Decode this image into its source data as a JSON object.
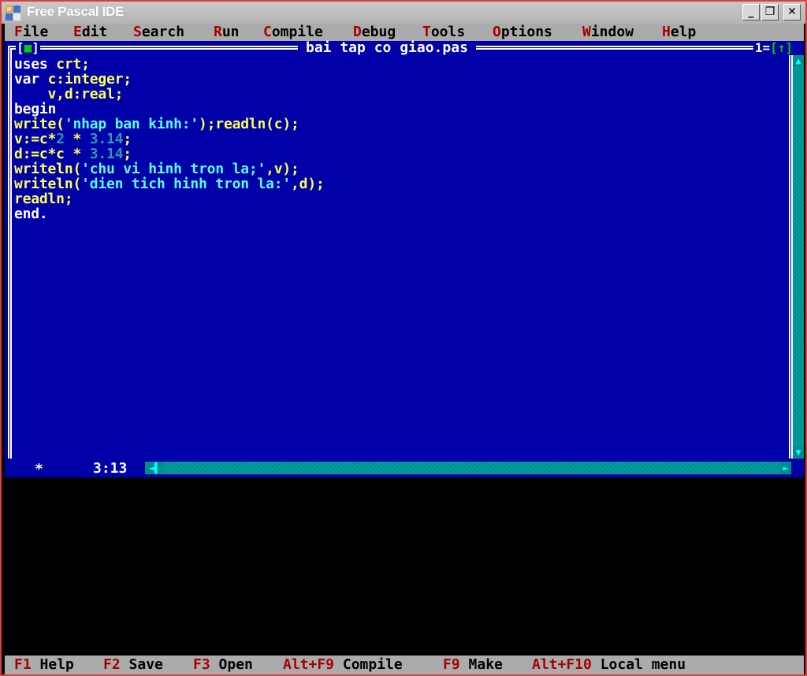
{
  "window": {
    "title": "Free Pascal IDE",
    "controls": {
      "minimize": "_",
      "restore": "❐",
      "close": "✕"
    }
  },
  "menu": [
    {
      "hotkey": "F",
      "rest": "ile"
    },
    {
      "hotkey": "E",
      "rest": "dit"
    },
    {
      "hotkey": "S",
      "rest": "earch"
    },
    {
      "hotkey": "R",
      "rest": "un"
    },
    {
      "hotkey": "C",
      "rest": "ompile"
    },
    {
      "hotkey": "D",
      "rest": "ebug"
    },
    {
      "hotkey": "T",
      "rest": "ools"
    },
    {
      "hotkey": "O",
      "rest": "ptions"
    },
    {
      "hotkey": "W",
      "rest": "indow"
    },
    {
      "hotkey": "H",
      "rest": "elp"
    }
  ],
  "editor": {
    "close_box": {
      "open": "[",
      "mark": "■",
      "close": "]"
    },
    "file_name": "bai tap co giao.pas",
    "window_number": {
      "number": "1",
      "zoom": "[↑]"
    },
    "modified_marker": "*",
    "cursor_position": "3:13",
    "code": [
      [
        {
          "t": "uses ",
          "c": "kw"
        },
        {
          "t": "crt;",
          "c": "id"
        }
      ],
      [
        {
          "t": "var ",
          "c": "kw"
        },
        {
          "t": "c:integer;",
          "c": "id"
        }
      ],
      [
        {
          "t": "    v,d:real;",
          "c": "id"
        }
      ],
      [
        {
          "t": "begin",
          "c": "kw"
        }
      ],
      [
        {
          "t": "write(",
          "c": "id"
        },
        {
          "t": "'nhap ban kinh:'",
          "c": "str"
        },
        {
          "t": ");readln(c);",
          "c": "id"
        }
      ],
      [
        {
          "t": "v:=c*",
          "c": "id"
        },
        {
          "t": "2",
          "c": "num"
        },
        {
          "t": " * ",
          "c": "id"
        },
        {
          "t": "3.14",
          "c": "num"
        },
        {
          "t": ";",
          "c": "id"
        }
      ],
      [
        {
          "t": "d:=c*c * ",
          "c": "id"
        },
        {
          "t": "3.14",
          "c": "num"
        },
        {
          "t": ";",
          "c": "id"
        }
      ],
      [
        {
          "t": "writeln(",
          "c": "id"
        },
        {
          "t": "'chu vi hinh tron la;'",
          "c": "str"
        },
        {
          "t": ",v);",
          "c": "id"
        }
      ],
      [
        {
          "t": "writeln(",
          "c": "id"
        },
        {
          "t": "'dien tich hinh tron la:'",
          "c": "str"
        },
        {
          "t": ",d);",
          "c": "id"
        }
      ],
      [
        {
          "t": "readln;",
          "c": "id"
        }
      ],
      [
        {
          "t": "end.",
          "c": "kw"
        }
      ]
    ]
  },
  "status": [
    {
      "key": "F1",
      "label": "Help"
    },
    {
      "key": "F2",
      "label": "Save"
    },
    {
      "key": "F3",
      "label": "Open"
    },
    {
      "key": "Alt+F9",
      "label": "Compile"
    },
    {
      "key": "F9",
      "label": "Make"
    },
    {
      "key": "Alt+F10",
      "label": "Local menu"
    }
  ],
  "colors": {
    "editor_bg": "#0000a8",
    "menu_bg": "#ababab",
    "hotkey": "#a80000",
    "identifier": "#ffff55",
    "keyword": "#ffffff",
    "string": "#55ffff",
    "number": "#2a9cb0"
  }
}
